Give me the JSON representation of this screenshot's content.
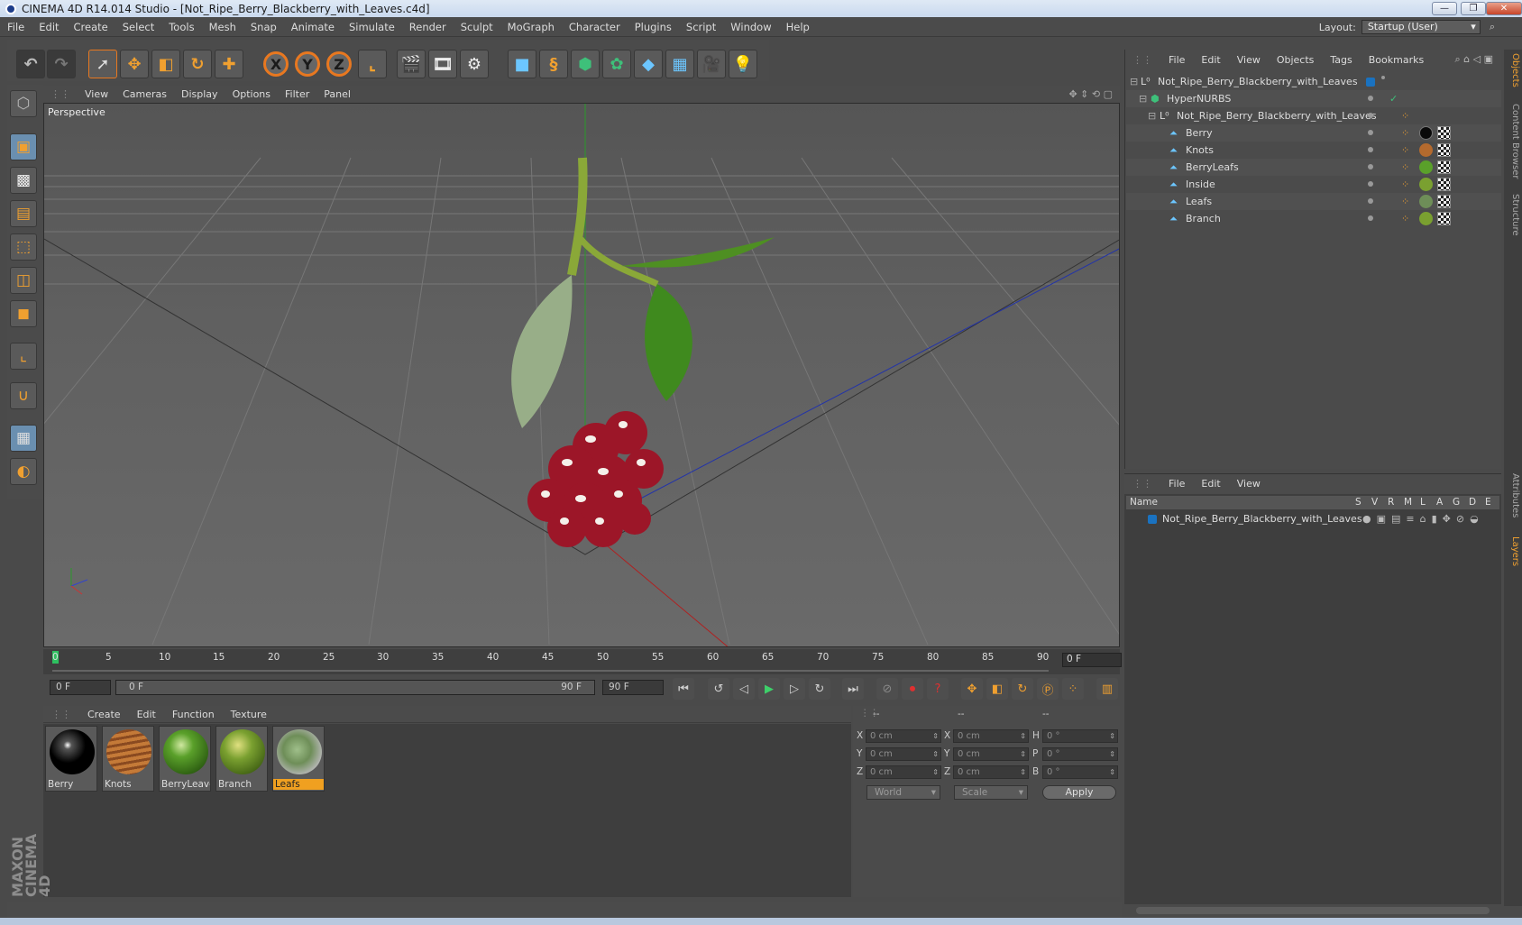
{
  "window": {
    "title": "CINEMA 4D R14.014 Studio - [Not_Ripe_Berry_Blackberry_with_Leaves.c4d]"
  },
  "menubar": [
    "File",
    "Edit",
    "Create",
    "Select",
    "Tools",
    "Mesh",
    "Snap",
    "Animate",
    "Simulate",
    "Render",
    "Sculpt",
    "MoGraph",
    "Character",
    "Plugins",
    "Script",
    "Window",
    "Help"
  ],
  "layout": {
    "label": "Layout:",
    "value": "Startup (User)"
  },
  "viewport": {
    "menu": [
      "View",
      "Cameras",
      "Display",
      "Options",
      "Filter",
      "Panel"
    ],
    "camera_label": "Perspective"
  },
  "timeline": {
    "ticks": [
      "0",
      "5",
      "10",
      "15",
      "20",
      "25",
      "30",
      "35",
      "40",
      "45",
      "50",
      "55",
      "60",
      "65",
      "70",
      "75",
      "80",
      "85",
      "90"
    ],
    "current_frame": "0 F",
    "start_field": "0 F",
    "range_start": "0 F",
    "range_end": "90 F",
    "end_field": "90 F"
  },
  "materials": {
    "menu": [
      "Create",
      "Edit",
      "Function",
      "Texture"
    ],
    "items": [
      {
        "name": "Berry",
        "color": "#0a0a0a"
      },
      {
        "name": "Knots",
        "color": "#b46a2e"
      },
      {
        "name": "BerryLeave",
        "color": "#5aa02a"
      },
      {
        "name": "Branch",
        "color": "#7aa030"
      },
      {
        "name": "Leafs",
        "color": "#6e8e58"
      }
    ],
    "selected": "Leafs"
  },
  "coordinates": {
    "header": [
      "--",
      "--",
      "--"
    ],
    "rows": [
      {
        "a": "X",
        "av": "0 cm",
        "b": "X",
        "bv": "0 cm",
        "c": "H",
        "cv": "0 °"
      },
      {
        "a": "Y",
        "av": "0 cm",
        "b": "Y",
        "bv": "0 cm",
        "c": "P",
        "cv": "0 °"
      },
      {
        "a": "Z",
        "av": "0 cm",
        "b": "Z",
        "bv": "0 cm",
        "c": "B",
        "cv": "0 °"
      }
    ],
    "mode": "World",
    "transform": "Scale",
    "apply": "Apply"
  },
  "objects": {
    "menu": [
      "File",
      "Edit",
      "View",
      "Objects",
      "Tags",
      "Bookmarks"
    ],
    "items": [
      {
        "name": "Not_Ripe_Berry_Blackberry_with_Leaves",
        "indent": 0
      },
      {
        "name": "HyperNURBS",
        "indent": 1
      },
      {
        "name": "Not_Ripe_Berry_Blackberry_with_Leaves",
        "indent": 2
      },
      {
        "name": "Berry",
        "indent": 3
      },
      {
        "name": "Knots",
        "indent": 3
      },
      {
        "name": "BerryLeafs",
        "indent": 3
      },
      {
        "name": "Inside",
        "indent": 3
      },
      {
        "name": "Leafs",
        "indent": 3
      },
      {
        "name": "Branch",
        "indent": 3
      }
    ]
  },
  "layers": {
    "menu": [
      "File",
      "Edit",
      "View"
    ],
    "columns": [
      "Name",
      "S",
      "V",
      "R",
      "M",
      "L",
      "A",
      "G",
      "D",
      "E"
    ],
    "rows": [
      "Not_Ripe_Berry_Blackberry_with_Leaves"
    ]
  },
  "side_tabs": [
    "Objects",
    "Content Browser",
    "Structure",
    "Attributes",
    "Layers"
  ],
  "branding": "MAXON CINEMA 4D",
  "colors": {
    "accent": "#f0a020",
    "selected_layer": "#1a72c0"
  }
}
